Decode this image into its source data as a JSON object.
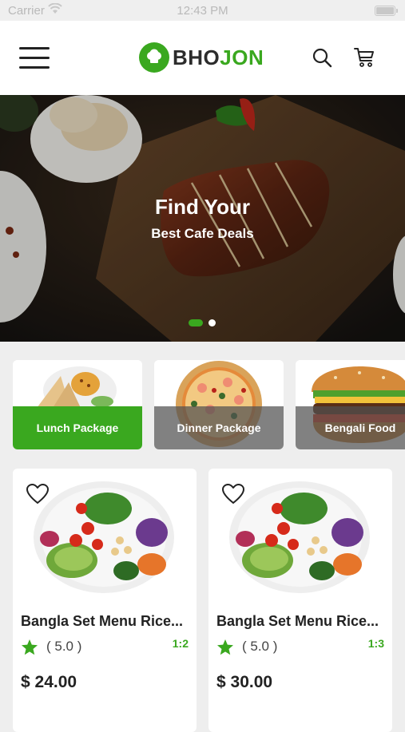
{
  "status": {
    "carrier": "Carrier",
    "time": "12:43 PM"
  },
  "header": {
    "logo_part1": "BHO",
    "logo_part2": "JON",
    "icons": [
      "menu-icon",
      "search-icon",
      "cart-icon"
    ]
  },
  "hero": {
    "title": "Find Your",
    "subtitle": "Best Cafe Deals",
    "slides_total": 2,
    "active_slide": 1
  },
  "categories": [
    {
      "label": "Lunch Package",
      "active": true
    },
    {
      "label": "Dinner Package",
      "active": false
    },
    {
      "label": "Bengali Food",
      "active": false
    }
  ],
  "products": [
    {
      "name": "Bangla Set Menu Rice...",
      "rating": "( 5.0 )",
      "ratio": "1:2",
      "price": "$ 24.00"
    },
    {
      "name": "Bangla Set Menu Rice...",
      "rating": "( 5.0 )",
      "ratio": "1:3",
      "price": "$ 30.00"
    }
  ],
  "colors": {
    "accent": "#3aa81f",
    "background": "#eeeeee"
  }
}
